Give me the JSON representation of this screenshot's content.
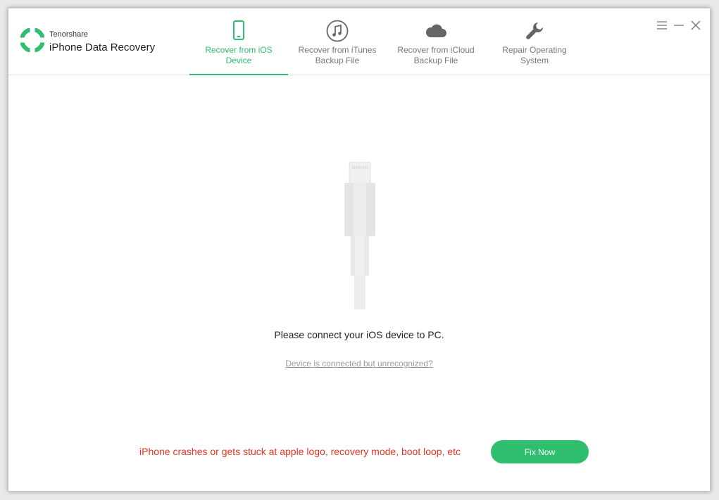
{
  "app": {
    "brand_small": "Tenorshare",
    "brand_title": "iPhone Data Recovery"
  },
  "tabs": [
    {
      "label": "Recover from iOS\nDevice",
      "icon": "phone-icon",
      "active": true
    },
    {
      "label": "Recover from iTunes\nBackup File",
      "icon": "music-note-icon",
      "active": false
    },
    {
      "label": "Recover from iCloud\nBackup File",
      "icon": "cloud-icon",
      "active": false
    },
    {
      "label": "Repair Operating\nSystem",
      "icon": "wrench-icon",
      "active": false
    }
  ],
  "window_controls": [
    "menu-icon",
    "minimize-icon",
    "close-icon"
  ],
  "main": {
    "connect_message": "Please connect your iOS device to PC.",
    "help_link": "Device is connected but unrecognized?"
  },
  "footer": {
    "warning": "iPhone crashes or gets stuck at apple logo, recovery mode, boot loop, etc",
    "fix_button": "Fix Now"
  },
  "colors": {
    "accent": "#2fbe6e",
    "warning": "#e8321e"
  }
}
